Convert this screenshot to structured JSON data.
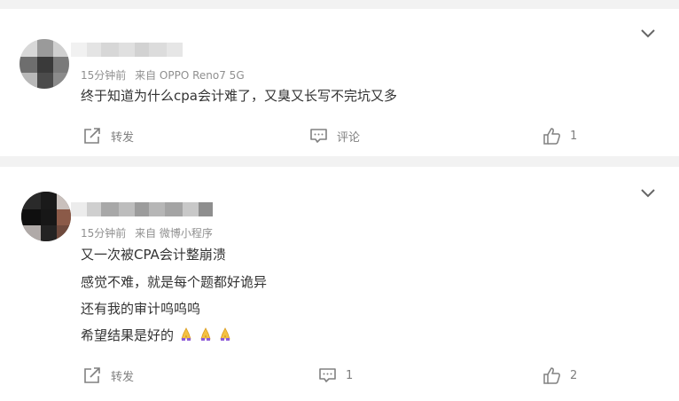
{
  "comments": [
    {
      "meta_time": "15分钟前",
      "meta_source": "来自 OPPO Reno7 5G",
      "lines": [
        "终于知道为什么cpa会计难了，又臭又长写不完坑又多"
      ],
      "repost_label": "转发",
      "comment_label": "评论",
      "like_count": "1"
    },
    {
      "meta_time": "15分钟前",
      "meta_source": "来自 微博小程序",
      "lines": [
        "又一次被CPA会计整崩溃",
        "感觉不难，就是每个题都好诡异",
        "还有我的审计呜呜呜",
        "希望结果是好的"
      ],
      "emoji_names": [
        "praying-hands-icon",
        "praying-hands-icon",
        "praying-hands-icon"
      ],
      "repost_label": "转发",
      "comment_label": "1",
      "like_count": "2"
    }
  ]
}
